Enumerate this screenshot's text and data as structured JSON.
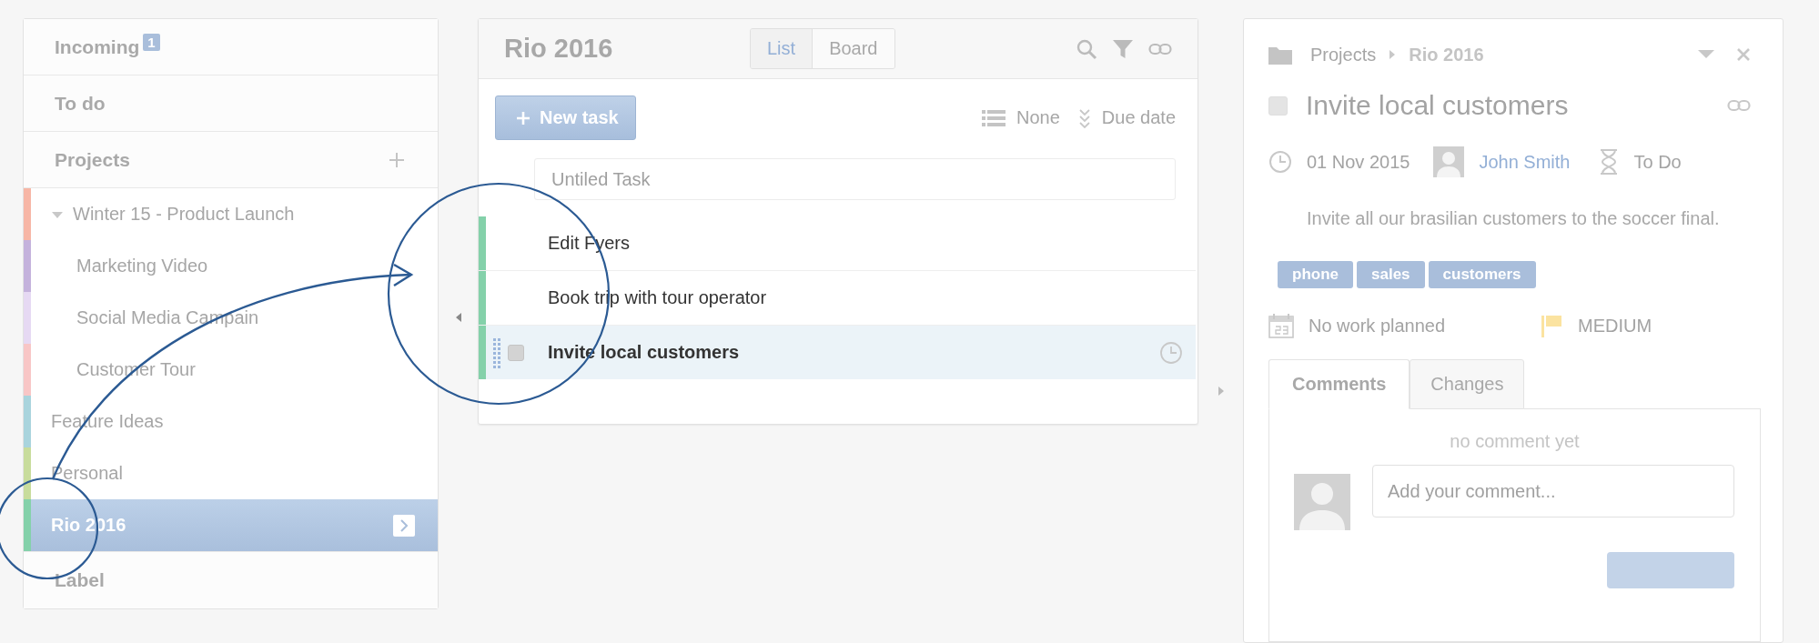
{
  "sidebar": {
    "inbox": {
      "label": "Incoming",
      "badge": "1"
    },
    "todo": {
      "label": "To do"
    },
    "projects": {
      "label": "Projects",
      "items": [
        {
          "label": "Winter 15 - Product Launch",
          "color": "#f7b6a6",
          "expanded": true,
          "selected": false,
          "children": [
            {
              "label": "Marketing Video",
              "color": "#c4b2dc",
              "selected": false
            },
            {
              "label": "Social Media Campain",
              "color": "#e6d9f3",
              "selected": false
            },
            {
              "label": "Customer Tour",
              "color": "#f8c6c6",
              "selected": false
            }
          ]
        },
        {
          "label": "Feature Ideas",
          "color": "#a9d4dd",
          "selected": false
        },
        {
          "label": "Personal",
          "color": "#c8dc9c",
          "selected": false
        },
        {
          "label": "Rio 2016",
          "color": "#84d1aa",
          "selected": true
        }
      ]
    },
    "labels": {
      "label": "Label"
    }
  },
  "task_list": {
    "title": "Rio 2016",
    "views": [
      {
        "label": "List",
        "selected": true
      },
      {
        "label": "Board",
        "selected": false
      }
    ],
    "new_task_button": "New task",
    "group_by": "None",
    "sort_by": "Due date",
    "new_task_field": {
      "placeholder": "Untiled Task"
    },
    "tasks": [
      {
        "title": "Edit Fyers",
        "color": "#84d1aa",
        "selected": false
      },
      {
        "title": "Book trip with tour operator",
        "color": "#84d1aa",
        "selected": false
      },
      {
        "title": "Invite local customers",
        "color": "#84d1aa",
        "selected": true
      }
    ]
  },
  "task_detail": {
    "breadcrumb": [
      "Projects",
      "Rio 2016"
    ],
    "title": "Invite local customers",
    "completed": false,
    "due_date": "01 Nov 2015",
    "assignee": "John Smith",
    "status": "To Do",
    "description": "Invite all our brasilian customers to the soccer final.",
    "tags": [
      "phone",
      "sales",
      "customers"
    ],
    "work": "No work planned",
    "priority": "MEDIUM",
    "tabs": [
      {
        "label": "Comments",
        "selected": true
      },
      {
        "label": "Changes",
        "selected": false
      }
    ],
    "empty_comments": "no comment yet",
    "comment_field": {
      "placeholder": "Add your comment..."
    }
  }
}
